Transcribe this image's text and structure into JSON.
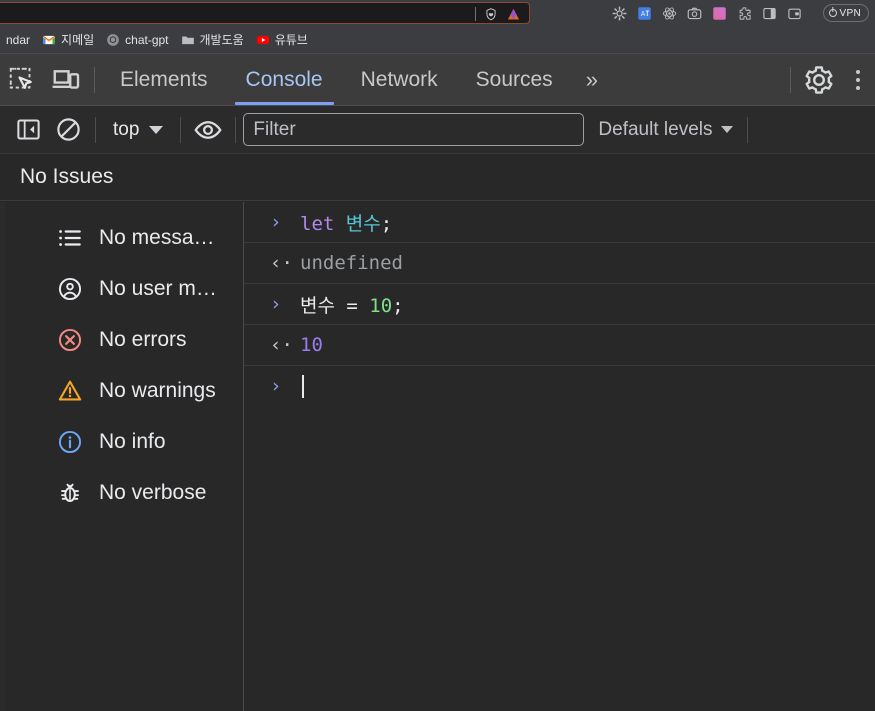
{
  "browser": {
    "bookmarks": [
      {
        "label": "ndar",
        "icon": "calendar-icon"
      },
      {
        "label": "지메일",
        "icon": "gmail-icon"
      },
      {
        "label": "chat-gpt",
        "icon": "chatgpt-icon"
      },
      {
        "label": "개발도움",
        "icon": "folder-icon"
      },
      {
        "label": "유튜브",
        "icon": "youtube-icon"
      }
    ],
    "omnibox_value": "",
    "omnibox_icons": [
      "brave-shield-lion-icon",
      "brave-triangle-icon"
    ],
    "extensions": [
      "gear-extension-icon",
      "translate-extension-icon",
      "react-devtools-icon",
      "screenshot-camera-icon",
      "gradient-square-icon",
      "puzzle-extensions-icon",
      "sidepanel-icon",
      "wallet-icon"
    ],
    "vpn_label": "VPN"
  },
  "devtools": {
    "left_buttons": [
      "inspect-element-icon",
      "device-toolbar-icon"
    ],
    "tabs": [
      {
        "label": "Elements",
        "active": false
      },
      {
        "label": "Console",
        "active": true
      },
      {
        "label": "Network",
        "active": false
      },
      {
        "label": "Sources",
        "active": false
      }
    ],
    "more_tabs_label": "»",
    "settings_icon": "gear-icon",
    "menu_icon": "kebab-menu-icon",
    "accent_color": "#7f9ff0"
  },
  "console_toolbar": {
    "sidebar_toggle_icon": "sidebar-toggle-icon",
    "clear_icon": "clear-console-icon",
    "context_label": "top",
    "eye_icon": "live-expression-eye-icon",
    "filter_placeholder": "Filter",
    "filter_value": "",
    "levels_label": "Default levels"
  },
  "issues": {
    "label": "No Issues"
  },
  "sidebar": {
    "items": [
      {
        "label": "No messa…",
        "icon": "message-list-icon",
        "color": "#e8eaed"
      },
      {
        "label": "No user m…",
        "icon": "user-message-icon",
        "color": "#e8eaed"
      },
      {
        "label": "No errors",
        "icon": "error-circle-icon",
        "color": "#f28b82"
      },
      {
        "label": "No warnings",
        "icon": "warning-triangle-icon",
        "color": "#f5a623"
      },
      {
        "label": "No info",
        "icon": "info-circle-icon",
        "color": "#6ba6f5"
      },
      {
        "label": "No verbose",
        "icon": "bug-icon",
        "color": "#e8eaed"
      }
    ]
  },
  "console_log": {
    "entries": [
      {
        "kind": "input",
        "gutter": "›",
        "tokens": [
          {
            "text": "let",
            "cls": "tok-kw"
          },
          {
            "text": " ",
            "cls": "tok-plain"
          },
          {
            "text": "변수",
            "cls": "tok-var"
          },
          {
            "text": ";",
            "cls": "tok-plain"
          }
        ]
      },
      {
        "kind": "output",
        "gutter": "‹·",
        "tokens": [
          {
            "text": "undefined",
            "cls": "tok-undef"
          }
        ]
      },
      {
        "kind": "input",
        "gutter": "›",
        "tokens": [
          {
            "text": "변수 = ",
            "cls": "tok-plain"
          },
          {
            "text": "10",
            "cls": "tok-num-in"
          },
          {
            "text": ";",
            "cls": "tok-plain"
          }
        ]
      },
      {
        "kind": "output",
        "gutter": "‹·",
        "tokens": [
          {
            "text": "10",
            "cls": "tok-num-out"
          }
        ]
      },
      {
        "kind": "prompt",
        "gutter": "›",
        "tokens": []
      }
    ]
  }
}
